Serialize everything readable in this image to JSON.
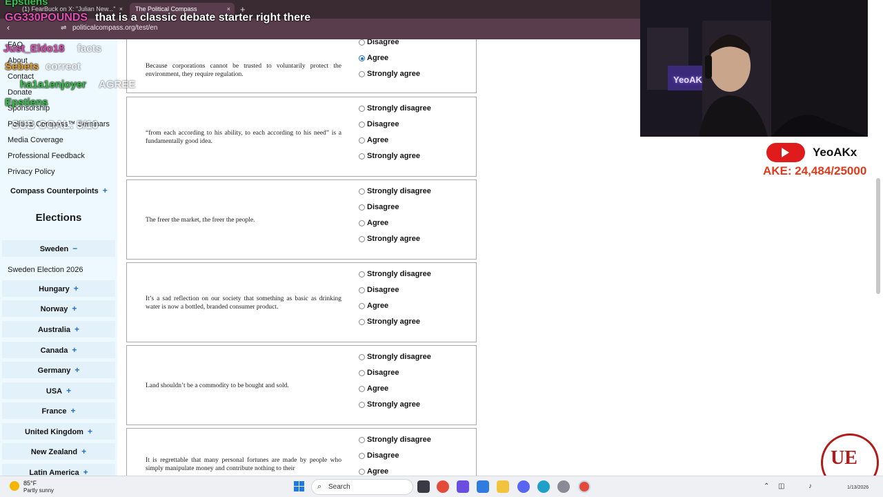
{
  "browser": {
    "tabs": [
      {
        "label": "(1) FearBuck on X: \"Julian New...\""
      },
      {
        "label": "The Political Compass"
      }
    ],
    "url": "politicalcompass.org/test/en",
    "new_tab": "+",
    "close": "×"
  },
  "sidebar": {
    "links": [
      {
        "label": "FAQ"
      },
      {
        "label": "About"
      },
      {
        "label": "Contact"
      },
      {
        "label": "Donate"
      },
      {
        "label": "Sponsorship"
      },
      {
        "label": "Political Compass™ Seminars"
      },
      {
        "label": "Media Coverage"
      },
      {
        "label": "Professional Feedback"
      },
      {
        "label": "Privacy Policy"
      }
    ],
    "counterpoints": "Compass Counterpoints",
    "elections_title": "Elections",
    "sweden": "Sweden",
    "sweden_election": "Sweden Election 2026",
    "countries": [
      "Hungary",
      "Norway",
      "Australia",
      "Canada",
      "Germany",
      "USA",
      "France",
      "United Kingdom",
      "New Zealand",
      "Latin America"
    ],
    "plus": "+",
    "minus": "−"
  },
  "questions": [
    {
      "text": "Because corporations cannot be trusted to voluntarily protect the environment, they require regulation.",
      "options": [
        "Disagree",
        "Agree",
        "Strongly agree"
      ],
      "selected": "Agree"
    },
    {
      "text": "“from each according to his ability, to each according to his need” is a fundamentally good idea.",
      "options": [
        "Strongly disagree",
        "Disagree",
        "Agree",
        "Strongly agree"
      ],
      "selected": ""
    },
    {
      "text": "The freer the market, the freer the people.",
      "options": [
        "Strongly disagree",
        "Disagree",
        "Agree",
        "Strongly agree"
      ],
      "selected": ""
    },
    {
      "text": "It’s a sad reflection on our society that something as basic as drinking water is now a bottled, branded consumer product.",
      "options": [
        "Strongly disagree",
        "Disagree",
        "Agree",
        "Strongly agree"
      ],
      "selected": ""
    },
    {
      "text": "Land shouldn’t be a commodity to be bought and sold.",
      "options": [
        "Strongly disagree",
        "Disagree",
        "Agree",
        "Strongly agree"
      ],
      "selected": ""
    },
    {
      "text": "It is regrettable that many personal fortunes are made by people who simply manipulate money and contribute nothing to their",
      "options": [
        "Strongly disagree",
        "Disagree",
        "Agree"
      ],
      "selected": ""
    }
  ],
  "chat": [
    {
      "user": "Epstiens",
      "message": "",
      "user_color": "#36c24a"
    },
    {
      "user": "GG330POUNDS",
      "message": "that is a classic debate starter right there",
      "user_color": "#e04fb3"
    },
    {
      "user": "Just_Eldo18",
      "message": "facts",
      "user_color": "#e04fb3"
    },
    {
      "user": "Sebets",
      "message": "correct",
      "user_color": "#e8a630"
    },
    {
      "user": "ha1a1enjoyer",
      "message": "AGREE",
      "user_color": "#36c24a"
    },
    {
      "user": "Epstiens",
      "message": "",
      "user_color": "#36c24a"
    },
    {
      "user": "",
      "message": "SUB GOAL: 5/10",
      "user_color": "#ffffff"
    }
  ],
  "stream": {
    "channel": "YeoAKx",
    "goal": "AKE: 24,484/25000",
    "logo": "UE",
    "neon_sign": "YeoAK"
  },
  "taskbar": {
    "temp": "85°F",
    "weather": "Partly sunny",
    "search": "Search",
    "date": "1/13/2026"
  },
  "colors": {
    "accent": "#1a6ed8",
    "sidebar_bg": "#eef8ff",
    "goal_red": "#e23a1c",
    "youtube_red": "#e01b1b"
  }
}
